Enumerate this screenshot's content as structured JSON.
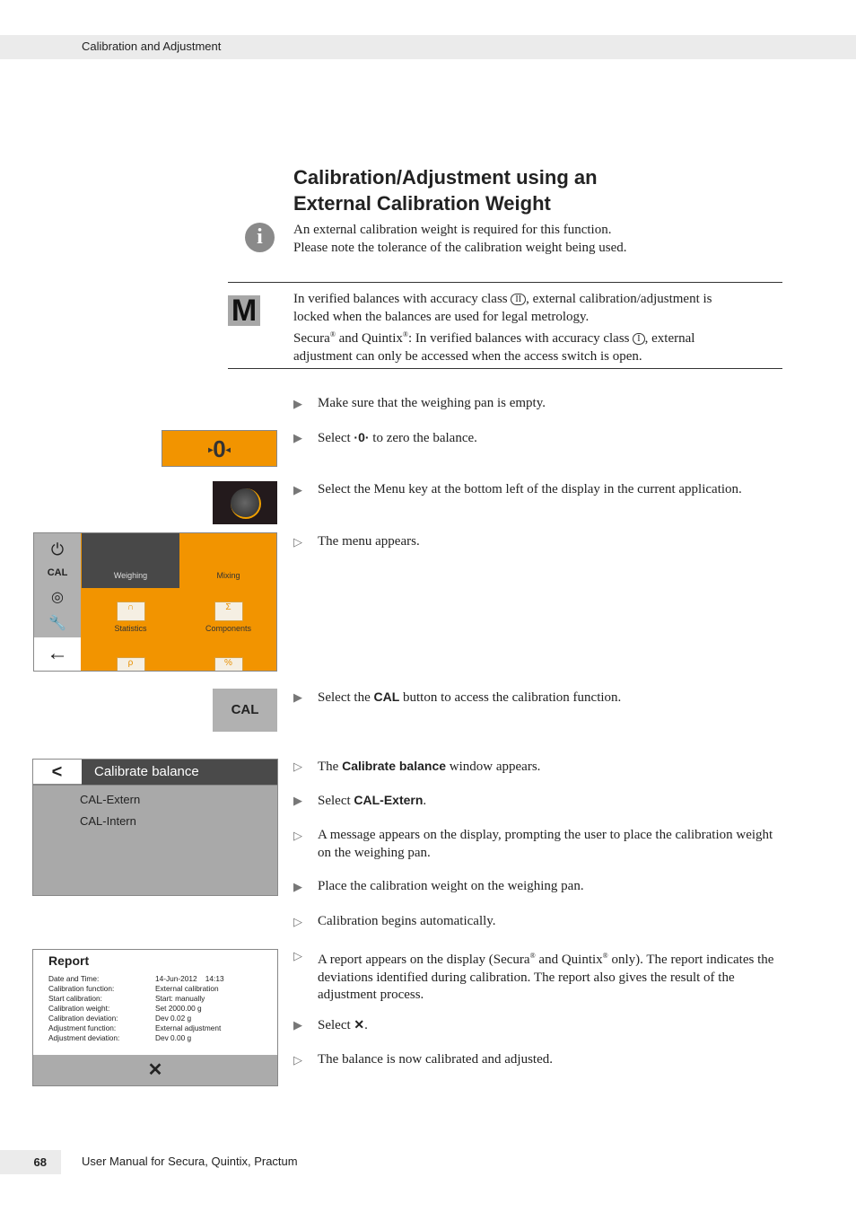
{
  "header": {
    "section": "Calibration and Adjustment"
  },
  "title_line1": "Calibration/Adjustment using an",
  "title_line2": "External Calibration Weight",
  "info": {
    "icon": "info-icon",
    "line1": "An external calibration weight is required for this function.",
    "line2": "Please note the tolerance of the calibration weight being used."
  },
  "metrology": {
    "icon_letter": "M",
    "l1a": "In verified balances with accuracy class ",
    "class2": "II",
    "l1b": ", external calibration/adjustment is",
    "l2": "locked when the balances are used for legal metrology.",
    "l3a": "Secura",
    "reg": "®",
    "l3b": " and Quintix",
    "l3c": ": In verified balances with accuracy class ",
    "class1": "I",
    "l3d": ", external",
    "l4": "adjustment can only be accessed when the access switch is open."
  },
  "markers": {
    "action": "▶",
    "result": "▷"
  },
  "steps": [
    {
      "type": "action",
      "parts": [
        {
          "t": "Make sure that the weighing pan is empty."
        }
      ]
    },
    {
      "type": "action",
      "parts": [
        {
          "t": "Select "
        },
        {
          "t": "·0·",
          "b": true
        },
        {
          "t": " to zero the balance."
        }
      ]
    },
    {
      "type": "action",
      "parts": [
        {
          "t": "Select the Menu key at the bottom left of the display in the current application."
        }
      ]
    },
    {
      "type": "result",
      "parts": [
        {
          "t": "The menu appears."
        }
      ]
    },
    {
      "type": "action",
      "parts": [
        {
          "t": "Select the "
        },
        {
          "t": "CAL",
          "b": true
        },
        {
          "t": " button to access the calibration function."
        }
      ]
    },
    {
      "type": "result",
      "parts": [
        {
          "t": "The "
        },
        {
          "t": "Calibrate balance",
          "b": true
        },
        {
          "t": " window appears."
        }
      ]
    },
    {
      "type": "action",
      "parts": [
        {
          "t": "Select "
        },
        {
          "t": "CAL-Extern",
          "b": true
        },
        {
          "t": "."
        }
      ]
    },
    {
      "type": "result",
      "parts": [
        {
          "t": "A message appears on the display, prompting the user to place the calibration weight on the weighing pan."
        }
      ]
    },
    {
      "type": "action",
      "parts": [
        {
          "t": "Place the calibration weight on the weighing pan."
        }
      ]
    },
    {
      "type": "result",
      "parts": [
        {
          "t": "Calibration begins automatically."
        }
      ]
    },
    {
      "type": "result",
      "parts": [
        {
          "t": "A report appears on the display (Secura"
        },
        {
          "t": "®",
          "sup": true
        },
        {
          "t": " and Quintix"
        },
        {
          "t": "®",
          "sup": true
        },
        {
          "t": " only). The report indicates the deviations identified during calibration. The report also gives the result of the adjustment process."
        }
      ]
    },
    {
      "type": "action",
      "parts": [
        {
          "t": "Select "
        },
        {
          "t": "✕",
          "b": true
        },
        {
          "t": "."
        }
      ]
    },
    {
      "type": "result",
      "parts": [
        {
          "t": "The balance is now calibrated and adjusted."
        }
      ]
    }
  ],
  "zero_button": {
    "label": "0",
    "icon": "zero-arrows-icon"
  },
  "menu_key": {
    "icon": "menu-grid-icon"
  },
  "menu_screen": {
    "side": {
      "power": "⏻",
      "cal": "CAL",
      "target": "◎",
      "wrench": "🔧",
      "back": "←"
    },
    "tabs": [
      "Weighing",
      "Mixing"
    ],
    "apps": [
      "Statistics",
      "Components"
    ],
    "app_icons": [
      "∩",
      "Σ",
      "ρ",
      "%"
    ],
    "accent": "#f29400"
  },
  "cal_button": {
    "label": "CAL"
  },
  "calibrate_window": {
    "back": "<",
    "title": "Calibrate balance",
    "options": [
      "CAL-Extern",
      "CAL-Intern"
    ]
  },
  "report": {
    "title": "Report",
    "rows": [
      [
        "Date and Time:",
        "14-Jun-2012    14:13"
      ],
      [
        "Calibration function:",
        "External calibration"
      ],
      [
        "Start calibration:",
        "Start: manually"
      ],
      [
        "Calibration weight:",
        "Set 2000.00 g"
      ],
      [
        "Calibration deviation:",
        "Dev 0.02 g"
      ],
      [
        "Adjustment function:",
        "External adjustment"
      ],
      [
        "Adjustment deviation:",
        "Dev 0.00 g"
      ]
    ],
    "close": "✕"
  },
  "footer": {
    "page": "68",
    "text": "User Manual for Secura, Quintix, Practum"
  }
}
